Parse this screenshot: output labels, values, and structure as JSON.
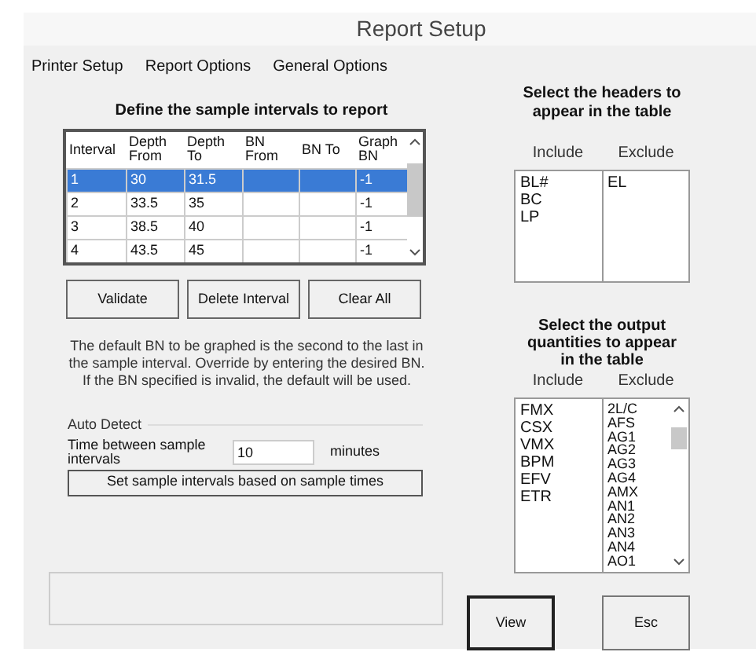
{
  "window": {
    "title": "Report Setup"
  },
  "menu": [
    {
      "label": "Printer Setup"
    },
    {
      "label": "Report Options"
    },
    {
      "label": "General Options"
    }
  ],
  "intervals": {
    "heading": "Define the sample intervals to report",
    "columns": [
      "Interval",
      "Depth From",
      "Depth To",
      "BN From",
      "BN To",
      "Graph BN"
    ],
    "rows": [
      {
        "cells": [
          "1",
          "30",
          "31.5",
          "",
          "",
          "-1"
        ],
        "selected": true
      },
      {
        "cells": [
          "2",
          "33.5",
          "35",
          "",
          "",
          "-1"
        ],
        "selected": false
      },
      {
        "cells": [
          "3",
          "38.5",
          "40",
          "",
          "",
          "-1"
        ],
        "selected": false
      },
      {
        "cells": [
          "4",
          "43.5",
          "45",
          "",
          "",
          "-1"
        ],
        "selected": false
      }
    ],
    "buttons": [
      "Validate",
      "Delete Interval",
      "Clear All"
    ],
    "note": "The default BN to be graphed is the second to the last in the sample interval.  Override by entering the desired BN. If the BN specified is invalid, the default will be used."
  },
  "auto_detect": {
    "title": "Auto Detect",
    "label": "Time between sample intervals",
    "value": "10",
    "unit": "minutes",
    "button": "Set sample intervals based on sample times"
  },
  "headers": {
    "heading": "Select the headers to appear in the table",
    "include_label": "Include",
    "exclude_label": "Exclude",
    "include": [
      "BL#",
      "BC",
      "LP"
    ],
    "exclude": [
      "EL"
    ]
  },
  "quantities": {
    "heading": "Select the output quantities to appear in the table",
    "include_label": "Include",
    "exclude_label": "Exclude",
    "include": [
      "FMX",
      "CSX",
      "VMX",
      "BPM",
      "EFV",
      "ETR"
    ],
    "exclude": [
      "2L/C",
      "AFS",
      "AG1",
      "AG2",
      "AG3",
      "AG4",
      "AMX",
      "AN1",
      "AN2",
      "AN3",
      "AN4",
      "AO1"
    ]
  },
  "buttons": [
    {
      "label": "View",
      "default": true
    },
    {
      "label": "Esc",
      "default": false
    }
  ]
}
